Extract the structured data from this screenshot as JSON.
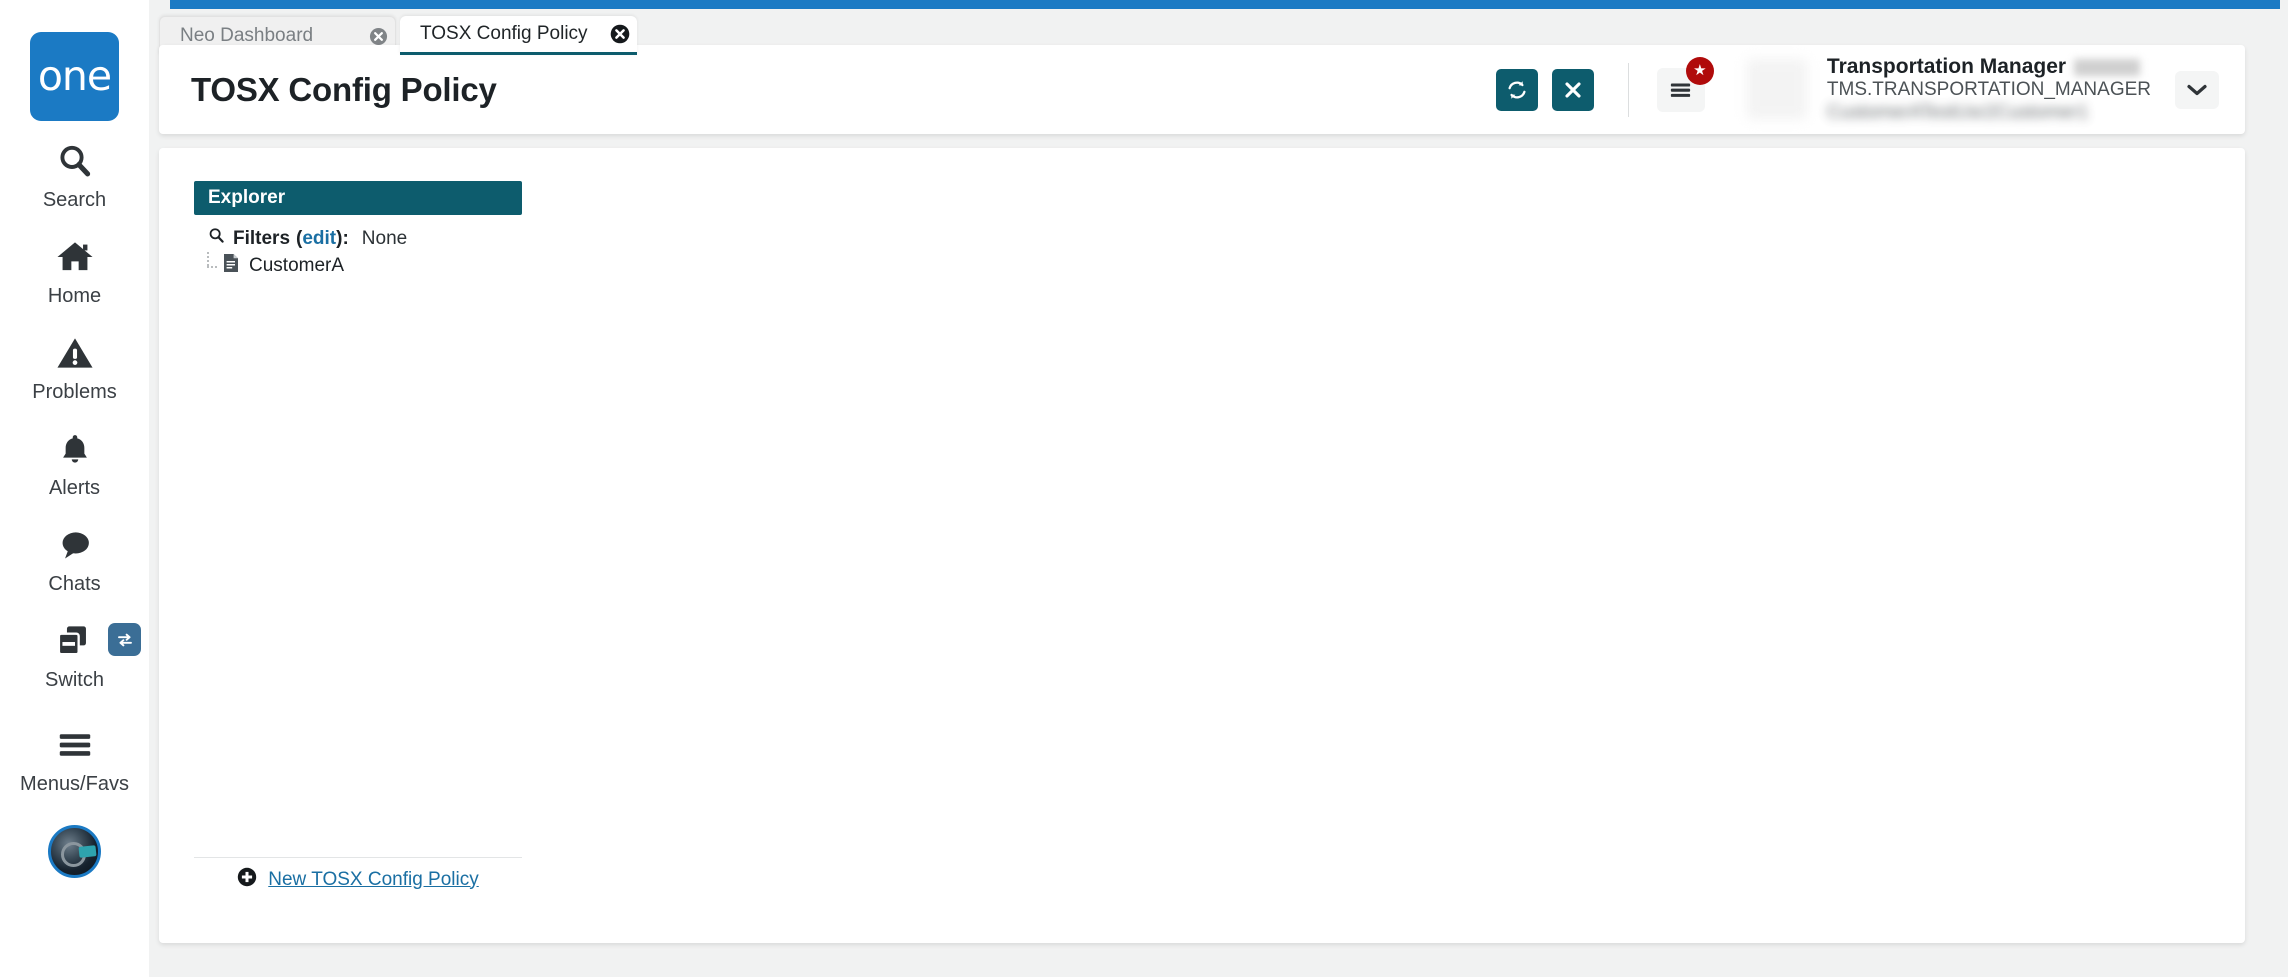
{
  "theme": {
    "brand_blue": "#1b7ac4",
    "teal": "#0d5c6d",
    "badge_red": "#b00b0b",
    "link_blue": "#1a6fa3",
    "page_bg": "#f1f2f2",
    "switch_badge_blue": "#3b6e96"
  },
  "rail": {
    "logo_text": "one",
    "items": [
      {
        "label": "Search",
        "icon": "search-icon"
      },
      {
        "label": "Home",
        "icon": "home-icon"
      },
      {
        "label": "Problems",
        "icon": "warning-triangle-icon"
      },
      {
        "label": "Alerts",
        "icon": "bell-icon"
      },
      {
        "label": "Chats",
        "icon": "chat-bubble-icon"
      },
      {
        "label": "Switch",
        "icon": "windows-stack-icon"
      },
      {
        "label": "Menus/Favs",
        "icon": "hamburger-icon"
      }
    ],
    "avatar_icon": "robot-avatar-icon"
  },
  "tabs": [
    {
      "label": "Neo Dashboard",
      "active": false,
      "close_icon": "close-circle-icon"
    },
    {
      "label": "TOSX Config Policy",
      "active": true,
      "close_icon": "close-circle-icon"
    }
  ],
  "header": {
    "title": "TOSX Config Policy",
    "refresh_button": {
      "icon": "refresh-icon",
      "label": "Refresh"
    },
    "close_button": {
      "icon": "x-icon",
      "label": "Close"
    },
    "menu_button": {
      "icon": "hamburger-icon",
      "badge_icon": "star-icon",
      "badge_glyph": "★"
    },
    "user": {
      "role": "Transportation Manager",
      "code": "TMS.TRANSPORTATION_MANAGER",
      "org": "CustomerATestUsr2Customer1",
      "avatar_icon": "user-avatar",
      "caret_icon": "chevron-down-icon"
    }
  },
  "explorer": {
    "title": "Explorer",
    "filters": {
      "search_icon": "search-icon",
      "label": "Filters",
      "edit_label": "edit",
      "open_paren": "(",
      "close_paren": ")",
      "colon": ":",
      "value": "None"
    },
    "tree": [
      {
        "label": "CustomerA",
        "icon": "document-icon"
      }
    ],
    "footer": {
      "add_icon": "plus-circle-icon",
      "link_label": "New TOSX Config Policy"
    }
  }
}
